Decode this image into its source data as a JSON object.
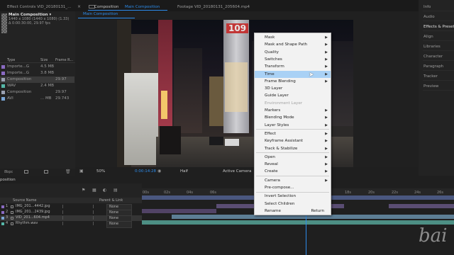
{
  "top_tabs": {
    "effect_controls": "Effect Controls VID_20180131_...",
    "composition_prefix": "Composition",
    "composition_name": "Main Composition",
    "footage": "Footage  VID_20180131_205604.mp4",
    "viewer_tab": "Main Composition"
  },
  "project": {
    "comp_name": "Main Composition ▾",
    "comp_info_1": "1440 x 1080  (1440 x 1080) (1.33)",
    "comp_info_2": "Δ 0:00:30:00, 29.97 fps",
    "columns": {
      "type": "Type",
      "size": "Size",
      "frame": "Frame R..."
    },
    "rows": [
      {
        "name": "Importe...G",
        "size": "4.5 MB",
        "frame": "",
        "color": "#8a6ac2"
      },
      {
        "name": "Importe...G",
        "size": "3.8 MB",
        "frame": "",
        "color": "#8a6ac2"
      },
      {
        "name": "Composition",
        "size": "",
        "frame": "29.97",
        "color": "#9aa1b1"
      },
      {
        "name": "WAV",
        "size": "2.4 MB",
        "frame": "",
        "color": "#55b6a7"
      },
      {
        "name": "Composition",
        "size": "",
        "frame": "29.97",
        "color": "#9aa1b1"
      },
      {
        "name": "AVI",
        "size": "... MB",
        "frame": "29.743",
        "color": "#7aa6d6"
      }
    ],
    "bpc": "8bpc"
  },
  "viewer_bar": {
    "zoom": "50%",
    "timecode": "0:00:14:28",
    "resolution": "Half",
    "camera": "Active Camera"
  },
  "right_panel": [
    "Info",
    "Audio",
    "Effects & Presets",
    "Align",
    "Libraries",
    "Character",
    "Paragraph",
    "Tracker",
    "Preview"
  ],
  "context_menu": [
    {
      "label": "Mask",
      "submenu": true
    },
    {
      "label": "Mask and Shape Path",
      "submenu": true
    },
    {
      "label": "Quality",
      "submenu": true
    },
    {
      "label": "Switches",
      "submenu": true
    },
    {
      "label": "Transform",
      "submenu": true
    },
    {
      "label": "Time",
      "submenu": true,
      "highlight": true
    },
    {
      "label": "Frame Blending",
      "submenu": true
    },
    {
      "label": "3D Layer"
    },
    {
      "label": "Guide Layer"
    },
    {
      "label": "Environment Layer",
      "disabled": true
    },
    {
      "label": "Markers",
      "submenu": true
    },
    {
      "label": "Blending Mode",
      "submenu": true
    },
    {
      "label": "Layer Styles",
      "submenu": true,
      "sep_after": true
    },
    {
      "label": "Effect",
      "submenu": true
    },
    {
      "label": "Keyframe Assistant",
      "submenu": true
    },
    {
      "label": "Track & Stabilize",
      "submenu": true,
      "sep_after": true
    },
    {
      "label": "Open",
      "submenu": true
    },
    {
      "label": "Reveal",
      "submenu": true
    },
    {
      "label": "Create",
      "submenu": true,
      "sep_after": true
    },
    {
      "label": "Camera",
      "submenu": true
    },
    {
      "label": "Pre-compose...",
      "sep_after": true
    },
    {
      "label": "Invert Selection"
    },
    {
      "label": "Select Children"
    },
    {
      "label": "Rename",
      "shortcut": "Return"
    }
  ],
  "timeline": {
    "tab": "position",
    "source_header": "Source Name",
    "parent_header": "Parent & Link",
    "layers": [
      {
        "num": "1",
        "name": "IMG_201...4442.jpg",
        "parent": "None",
        "color": "#8a6ac2"
      },
      {
        "num": "2",
        "name": "IMG_201...2439.jpg",
        "parent": "None",
        "color": "#8a6ac2"
      },
      {
        "num": "3",
        "name": "VID_201...604.mp4",
        "parent": "None",
        "color": "#7aa6d6"
      },
      {
        "num": "4",
        "name": "Rhythm.wav",
        "parent": "None",
        "color": "#55b6a7"
      }
    ],
    "ruler": [
      "00s",
      "02s",
      "04s",
      "06s",
      "18s",
      "20s",
      "22s",
      "24s",
      "26s"
    ]
  },
  "scene": {
    "sign_text": "109"
  },
  "watermark": "bai",
  "colors": {
    "accent": "#2d8ceb",
    "menu_highlight": "#a9d1f5"
  }
}
